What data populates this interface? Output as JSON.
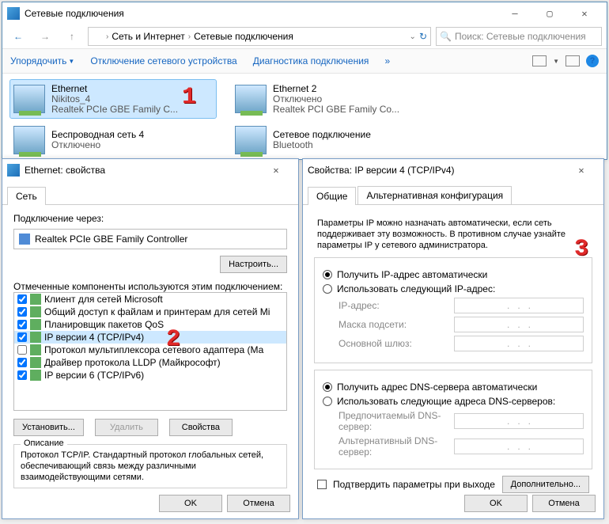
{
  "explorer": {
    "title": "Сетевые подключения",
    "breadcrumbs": [
      "Сеть и Интернет",
      "Сетевые подключения"
    ],
    "search_placeholder": "Поиск: Сетевые подключения",
    "toolbar": {
      "organize": "Упорядочить",
      "disable": "Отключение сетевого устройства",
      "diagnose": "Диагностика подключения"
    },
    "connections": [
      {
        "name": "Ethernet",
        "status": "Nikitos_4",
        "device": "Realtek PCIe GBE Family C...",
        "selected": true
      },
      {
        "name": "Ethernet 2",
        "status": "Отключено",
        "device": "Realtek PCI GBE Family Co...",
        "selected": false
      },
      {
        "name": "Беспроводная сеть 4",
        "status": "Отключено",
        "device": "",
        "selected": false
      },
      {
        "name": "Сетевое подключение",
        "status": "Bluetooth",
        "device": "",
        "selected": false
      }
    ]
  },
  "props": {
    "title": "Ethernet: свойства",
    "tab_net": "Сеть",
    "connect_via": "Подключение через:",
    "adapter": "Realtek PCIe GBE Family Controller",
    "configure": "Настроить...",
    "components_label": "Отмеченные компоненты используются этим подключением:",
    "components": [
      "Клиент для сетей Microsoft",
      "Общий доступ к файлам и принтерам для сетей Mi",
      "Планировщик пакетов QoS",
      "IP версии 4 (TCP/IPv4)",
      "Протокол мультиплексора сетевого адаптера (Ма",
      "Драйвер протокола LLDP (Майкрософт)",
      "IP версии 6 (TCP/IPv6)"
    ],
    "sel_index": 3,
    "install": "Установить...",
    "remove": "Удалить",
    "properties": "Свойства",
    "desc_title": "Описание",
    "desc": "Протокол TCP/IP. Стандартный протокол глобальных сетей, обеспечивающий связь между различными взаимодействующими сетями.",
    "ok": "OK",
    "cancel": "Отмена"
  },
  "ipv4": {
    "title": "Свойства: IP версии 4 (TCP/IPv4)",
    "tab_general": "Общие",
    "tab_alt": "Альтернативная конфигурация",
    "intro": "Параметры IP можно назначать автоматически, если сеть поддерживает эту возможность. В противном случае узнайте параметры IP у сетевого администратора.",
    "radio_auto_ip": "Получить IP-адрес автоматически",
    "radio_manual_ip": "Использовать следующий IP-адрес:",
    "ip_addr": "IP-адрес:",
    "mask": "Маска подсети:",
    "gateway": "Основной шлюз:",
    "radio_auto_dns": "Получить адрес DNS-сервера автоматически",
    "radio_manual_dns": "Использовать следующие адреса DNS-серверов:",
    "dns1": "Предпочитаемый DNS-сервер:",
    "dns2": "Альтернативный DNS-сервер:",
    "confirm_exit": "Подтвердить параметры при выходе",
    "advanced": "Дополнительно...",
    "ok": "OK",
    "cancel": "Отмена"
  },
  "annotations": {
    "n1": "1",
    "n2": "2",
    "n3": "3"
  }
}
